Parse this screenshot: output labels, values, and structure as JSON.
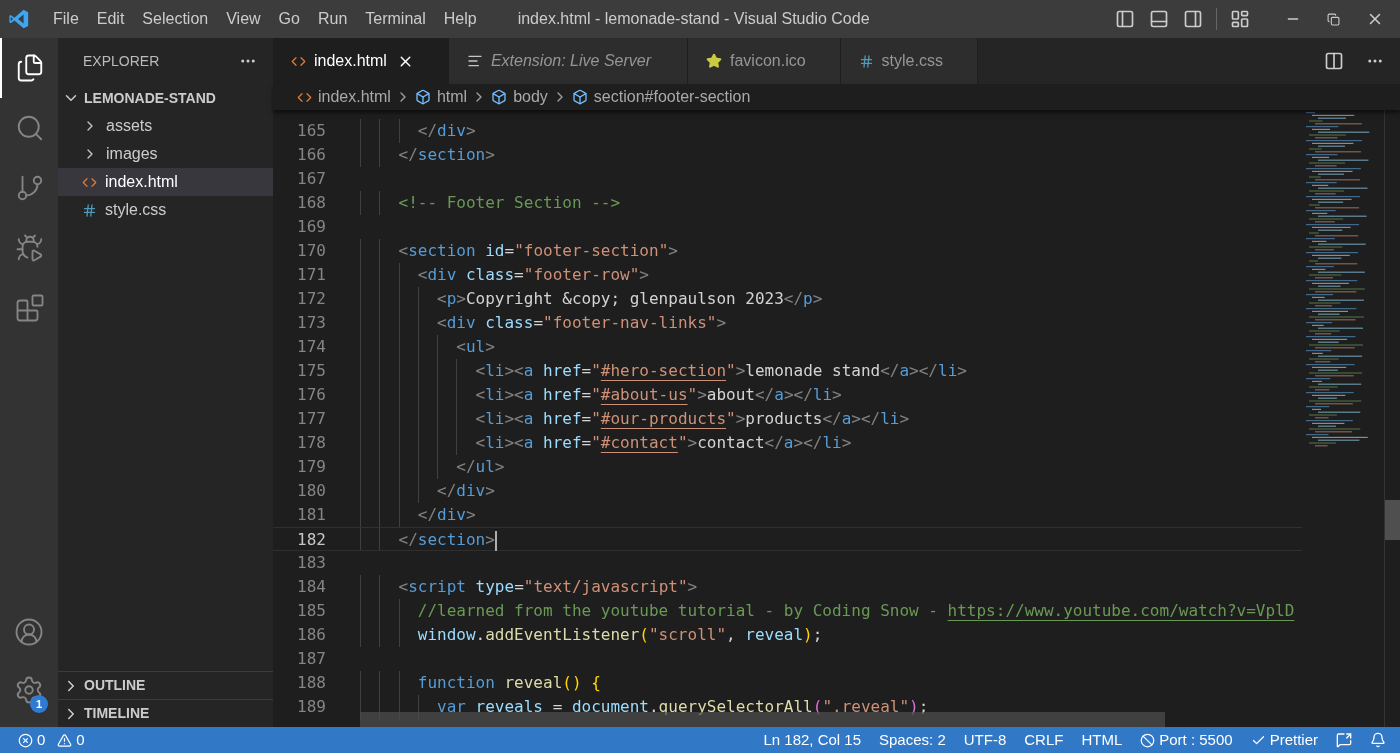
{
  "window": {
    "title": "index.html - lemonade-stand - Visual Studio Code"
  },
  "menu": [
    "File",
    "Edit",
    "Selection",
    "View",
    "Go",
    "Run",
    "Terminal",
    "Help"
  ],
  "activity_bar": [
    {
      "kind": "explorer",
      "selected": true
    },
    {
      "kind": "search",
      "selected": false
    },
    {
      "kind": "source-control",
      "selected": false
    },
    {
      "kind": "run-debug",
      "selected": false
    },
    {
      "kind": "extensions",
      "selected": false
    }
  ],
  "activity_bar_bottom": [
    {
      "kind": "account"
    },
    {
      "kind": "settings",
      "badge": "1"
    }
  ],
  "sidebar": {
    "title": "EXPLORER",
    "folder": {
      "name": "LEMONADE-STAND",
      "expanded": true,
      "children": [
        {
          "name": "assets",
          "kind": "folder",
          "selected": false
        },
        {
          "name": "images",
          "kind": "folder",
          "selected": false
        },
        {
          "name": "index.html",
          "kind": "html",
          "selected": true
        },
        {
          "name": "style.css",
          "kind": "css",
          "selected": false
        }
      ]
    },
    "sections": [
      {
        "name": "OUTLINE",
        "expanded": false
      },
      {
        "name": "TIMELINE",
        "expanded": false
      }
    ]
  },
  "tabs": [
    {
      "label": "index.html",
      "kind": "html",
      "selected": true
    },
    {
      "label": "Extension: Live Server",
      "kind": "extension",
      "selected": false
    },
    {
      "label": "favicon.ico",
      "kind": "image",
      "selected": false
    },
    {
      "label": "style.css",
      "kind": "css",
      "selected": false
    }
  ],
  "breadcrumbs": [
    {
      "label": "index.html",
      "kind": "file"
    },
    {
      "label": "html",
      "kind": "element"
    },
    {
      "label": "body",
      "kind": "element"
    },
    {
      "label": "section#footer-section",
      "kind": "element"
    }
  ],
  "editor": {
    "lines": [
      {
        "children": [
          {
            "number": "165",
            "current": false,
            "tokens": [
              {
                "kind": "p",
                "text": "</"
              },
              {
                "kind": "tag",
                "text": "div"
              },
              {
                "kind": "p",
                "text": ">"
              }
            ]
          }
        ]
      },
      {
        "number": "166",
        "current": false,
        "tokens": [
          {
            "kind": "p",
            "text": "</"
          },
          {
            "kind": "tag",
            "text": "section"
          },
          {
            "kind": "p",
            "text": ">"
          }
        ]
      },
      {
        "number": "167",
        "current": false
      },
      {
        "number": "168",
        "current": false,
        "tokens": [
          {
            "kind": "comment",
            "text": "<!-- Footer Section -->"
          }
        ]
      },
      {
        "number": "169",
        "current": false
      },
      {
        "number": "170",
        "current": false,
        "tokens": [
          {
            "kind": "p",
            "text": "<"
          },
          {
            "kind": "tag",
            "text": "section"
          },
          {
            "kind": "attr",
            "text": " id"
          },
          {
            "kind": "text",
            "text": "="
          },
          {
            "kind": "str",
            "text": "\"footer-section\""
          },
          {
            "kind": "p",
            "text": ">"
          }
        ],
        "children": [
          {
            "number": "171",
            "current": false,
            "tokens": [
              {
                "kind": "p",
                "text": "<"
              },
              {
                "kind": "tag",
                "text": "div"
              },
              {
                "kind": "attr",
                "text": " class"
              },
              {
                "kind": "text",
                "text": "="
              },
              {
                "kind": "str",
                "text": "\"footer-row\""
              },
              {
                "kind": "p",
                "text": ">"
              }
            ],
            "children": [
              {
                "number": "172",
                "current": false,
                "tokens": [
                  {
                    "kind": "p",
                    "text": "<"
                  },
                  {
                    "kind": "tag",
                    "text": "p"
                  },
                  {
                    "kind": "p",
                    "text": ">"
                  },
                  {
                    "kind": "text",
                    "text": "Copyright &copy; glenpaulson 2023"
                  },
                  {
                    "kind": "p",
                    "text": "</"
                  },
                  {
                    "kind": "tag",
                    "text": "p"
                  },
                  {
                    "kind": "p",
                    "text": ">"
                  }
                ]
              },
              {
                "number": "173",
                "current": false,
                "tokens": [
                  {
                    "kind": "p",
                    "text": "<"
                  },
                  {
                    "kind": "tag",
                    "text": "div"
                  },
                  {
                    "kind": "attr",
                    "text": " class"
                  },
                  {
                    "kind": "text",
                    "text": "="
                  },
                  {
                    "kind": "str",
                    "text": "\"footer-nav-links\""
                  },
                  {
                    "kind": "p",
                    "text": ">"
                  }
                ],
                "children": [
                  {
                    "number": "174",
                    "current": false,
                    "tokens": [
                      {
                        "kind": "p",
                        "text": "<"
                      },
                      {
                        "kind": "tag",
                        "text": "ul"
                      },
                      {
                        "kind": "p",
                        "text": ">"
                      }
                    ],
                    "children": [
                      {
                        "number": "175",
                        "current": false,
                        "tokens": [
                          {
                            "kind": "p",
                            "text": "<"
                          },
                          {
                            "kind": "tag",
                            "text": "li"
                          },
                          {
                            "kind": "p",
                            "text": "><"
                          },
                          {
                            "kind": "tag",
                            "text": "a"
                          },
                          {
                            "kind": "attr",
                            "text": " href"
                          },
                          {
                            "kind": "text",
                            "text": "="
                          },
                          {
                            "kind": "str",
                            "text": "\""
                          },
                          {
                            "kind": "str-link",
                            "text": "#hero-section"
                          },
                          {
                            "kind": "str",
                            "text": "\""
                          },
                          {
                            "kind": "p",
                            "text": ">"
                          },
                          {
                            "kind": "text",
                            "text": "lemonade stand"
                          },
                          {
                            "kind": "p",
                            "text": "</"
                          },
                          {
                            "kind": "tag",
                            "text": "a"
                          },
                          {
                            "kind": "p",
                            "text": "></"
                          },
                          {
                            "kind": "tag",
                            "text": "li"
                          },
                          {
                            "kind": "p",
                            "text": ">"
                          }
                        ]
                      },
                      {
                        "number": "176",
                        "current": false,
                        "tokens": [
                          {
                            "kind": "p",
                            "text": "<"
                          },
                          {
                            "kind": "tag",
                            "text": "li"
                          },
                          {
                            "kind": "p",
                            "text": "><"
                          },
                          {
                            "kind": "tag",
                            "text": "a"
                          },
                          {
                            "kind": "attr",
                            "text": " href"
                          },
                          {
                            "kind": "text",
                            "text": "="
                          },
                          {
                            "kind": "str",
                            "text": "\""
                          },
                          {
                            "kind": "str-link",
                            "text": "#about-us"
                          },
                          {
                            "kind": "str",
                            "text": "\""
                          },
                          {
                            "kind": "p",
                            "text": ">"
                          },
                          {
                            "kind": "text",
                            "text": "about"
                          },
                          {
                            "kind": "p",
                            "text": "</"
                          },
                          {
                            "kind": "tag",
                            "text": "a"
                          },
                          {
                            "kind": "p",
                            "text": "></"
                          },
                          {
                            "kind": "tag",
                            "text": "li"
                          },
                          {
                            "kind": "p",
                            "text": ">"
                          }
                        ]
                      },
                      {
                        "number": "177",
                        "current": false,
                        "tokens": [
                          {
                            "kind": "p",
                            "text": "<"
                          },
                          {
                            "kind": "tag",
                            "text": "li"
                          },
                          {
                            "kind": "p",
                            "text": "><"
                          },
                          {
                            "kind": "tag",
                            "text": "a"
                          },
                          {
                            "kind": "attr",
                            "text": " href"
                          },
                          {
                            "kind": "text",
                            "text": "="
                          },
                          {
                            "kind": "str",
                            "text": "\""
                          },
                          {
                            "kind": "str-link",
                            "text": "#our-products"
                          },
                          {
                            "kind": "str",
                            "text": "\""
                          },
                          {
                            "kind": "p",
                            "text": ">"
                          },
                          {
                            "kind": "text",
                            "text": "products"
                          },
                          {
                            "kind": "p",
                            "text": "</"
                          },
                          {
                            "kind": "tag",
                            "text": "a"
                          },
                          {
                            "kind": "p",
                            "text": "></"
                          },
                          {
                            "kind": "tag",
                            "text": "li"
                          },
                          {
                            "kind": "p",
                            "text": ">"
                          }
                        ]
                      },
                      {
                        "number": "178",
                        "current": false,
                        "tokens": [
                          {
                            "kind": "p",
                            "text": "<"
                          },
                          {
                            "kind": "tag",
                            "text": "li"
                          },
                          {
                            "kind": "p",
                            "text": "><"
                          },
                          {
                            "kind": "tag",
                            "text": "a"
                          },
                          {
                            "kind": "attr",
                            "text": " href"
                          },
                          {
                            "kind": "text",
                            "text": "="
                          },
                          {
                            "kind": "str",
                            "text": "\""
                          },
                          {
                            "kind": "str-link",
                            "text": "#contact"
                          },
                          {
                            "kind": "str",
                            "text": "\""
                          },
                          {
                            "kind": "p",
                            "text": ">"
                          },
                          {
                            "kind": "text",
                            "text": "contact"
                          },
                          {
                            "kind": "p",
                            "text": "</"
                          },
                          {
                            "kind": "tag",
                            "text": "a"
                          },
                          {
                            "kind": "p",
                            "text": "></"
                          },
                          {
                            "kind": "tag",
                            "text": "li"
                          },
                          {
                            "kind": "p",
                            "text": ">"
                          }
                        ]
                      }
                    ]
                  },
                  {
                    "number": "179",
                    "current": false,
                    "tokens": [
                      {
                        "kind": "p",
                        "text": "</"
                      },
                      {
                        "kind": "tag",
                        "text": "ul"
                      },
                      {
                        "kind": "p",
                        "text": ">"
                      }
                    ]
                  }
                ]
              },
              {
                "number": "180",
                "current": false,
                "tokens": [
                  {
                    "kind": "p",
                    "text": "</"
                  },
                  {
                    "kind": "tag",
                    "text": "div"
                  },
                  {
                    "kind": "p",
                    "text": ">"
                  }
                ]
              }
            ]
          },
          {
            "number": "181",
            "current": false,
            "tokens": [
              {
                "kind": "p",
                "text": "</"
              },
              {
                "kind": "tag",
                "text": "div"
              },
              {
                "kind": "p",
                "text": ">"
              }
            ]
          }
        ]
      },
      {
        "number": "182",
        "current": true,
        "tokens": [
          {
            "kind": "p",
            "text": "</"
          },
          {
            "kind": "tag",
            "text": "section"
          },
          {
            "kind": "p",
            "text": ">"
          }
        ]
      },
      {
        "number": "183",
        "current": false
      },
      {
        "number": "184",
        "current": false,
        "tokens": [
          {
            "kind": "p",
            "text": "<"
          },
          {
            "kind": "tag",
            "text": "script"
          },
          {
            "kind": "attr",
            "text": " type"
          },
          {
            "kind": "text",
            "text": "="
          },
          {
            "kind": "str",
            "text": "\"text/javascript\""
          },
          {
            "kind": "p",
            "text": ">"
          }
        ],
        "children": [
          {
            "number": "185",
            "current": false,
            "tokens": [
              {
                "kind": "comment",
                "text": "//learned from the youtube tutorial - by Coding Snow - "
              },
              {
                "kind": "comment-link",
                "text": "https://www.youtube.com/watch?v=VplD"
              }
            ]
          },
          {
            "number": "186",
            "current": false,
            "tokens": [
              {
                "kind": "var",
                "text": "window"
              },
              {
                "kind": "text",
                "text": "."
              },
              {
                "kind": "func",
                "text": "addEventListener"
              },
              {
                "kind": "bracket1",
                "text": "("
              },
              {
                "kind": "str",
                "text": "\"scroll\""
              },
              {
                "kind": "text",
                "text": ", "
              },
              {
                "kind": "var",
                "text": "reveal"
              },
              {
                "kind": "bracket1",
                "text": ")"
              },
              {
                "kind": "text",
                "text": ";"
              }
            ]
          },
          {
            "number": "187",
            "current": false
          },
          {
            "number": "188",
            "current": false,
            "tokens": [
              {
                "kind": "keyword",
                "text": "function "
              },
              {
                "kind": "func",
                "text": "reveal"
              },
              {
                "kind": "bracket1",
                "text": "() {"
              }
            ],
            "children": [
              {
                "number": "189",
                "current": false,
                "tokens": [
                  {
                    "kind": "keyword",
                    "text": "var"
                  },
                  {
                    "kind": "var",
                    "text": " reveals"
                  },
                  {
                    "kind": "text",
                    "text": " = "
                  },
                  {
                    "kind": "var",
                    "text": "document"
                  },
                  {
                    "kind": "text",
                    "text": "."
                  },
                  {
                    "kind": "func",
                    "text": "querySelectorAll"
                  },
                  {
                    "kind": "bracket2",
                    "text": "("
                  },
                  {
                    "kind": "str",
                    "text": "\".reveal\""
                  },
                  {
                    "kind": "bracket2",
                    "text": ")"
                  },
                  {
                    "kind": "text",
                    "text": ";"
                  }
                ]
              }
            ]
          }
        ]
      }
    ]
  },
  "status_bar": {
    "left": [
      {
        "kind": "errors",
        "text": "0"
      },
      {
        "kind": "warnings",
        "text": "0"
      }
    ],
    "right": [
      {
        "kind": "text",
        "text": "Ln 182, Col 15"
      },
      {
        "kind": "text",
        "text": "Spaces: 2"
      },
      {
        "kind": "text",
        "text": "UTF-8"
      },
      {
        "kind": "text",
        "text": "CRLF"
      },
      {
        "kind": "text",
        "text": "HTML"
      },
      {
        "kind": "port",
        "text": "Port : 5500"
      },
      {
        "kind": "prettier",
        "text": "Prettier"
      },
      {
        "kind": "feedback"
      },
      {
        "kind": "notifications"
      }
    ]
  }
}
